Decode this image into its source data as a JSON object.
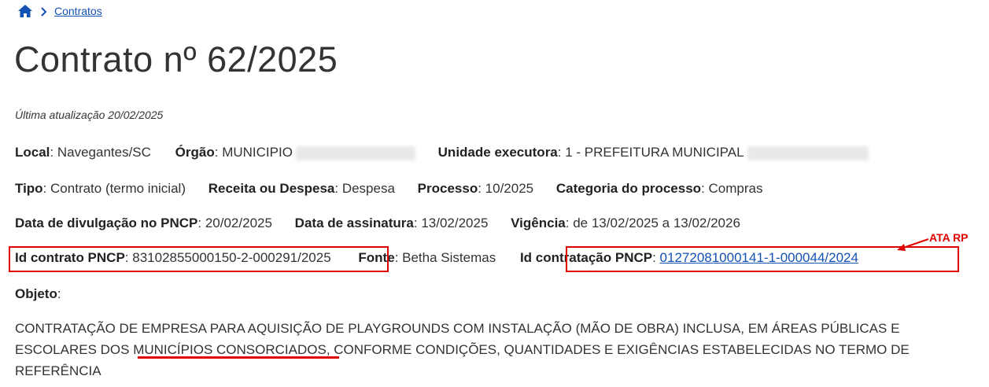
{
  "breadcrumb": {
    "home_icon": "home-icon",
    "separator_icon": "chevron-right-icon",
    "link": "Contratos"
  },
  "title": "Contrato nº 62/2025",
  "last_update": "Última atualização 20/02/2025",
  "fields": {
    "local_label": "Local",
    "local_value": "Navegantes/SC",
    "orgao_label": "Órgão",
    "orgao_value": "MUNICIPIO",
    "unidade_label": "Unidade executora",
    "unidade_value": "1 - PREFEITURA MUNICIPAL",
    "tipo_label": "Tipo",
    "tipo_value": "Contrato (termo inicial)",
    "receita_label": "Receita ou Despesa",
    "receita_value": "Despesa",
    "processo_label": "Processo",
    "processo_value": "10/2025",
    "categoria_label": "Categoria do processo",
    "categoria_value": "Compras",
    "divulgacao_label": "Data de divulgação no PNCP",
    "divulgacao_value": "20/02/2025",
    "assinatura_label": "Data de assinatura",
    "assinatura_value": "13/02/2025",
    "vigencia_label": "Vigência",
    "vigencia_value": "de 13/02/2025 a 13/02/2026",
    "id_contrato_label": "Id contrato PNCP",
    "id_contrato_value": "83102855000150-2-000291/2025",
    "fonte_label": "Fonte",
    "fonte_value": "Betha Sistemas",
    "id_contratacao_label": "Id contratação PNCP",
    "id_contratacao_value": "01272081000141-1-000044/2024",
    "objeto_label": "Objeto"
  },
  "objeto": {
    "part1": "CONTRATAÇÃO DE EMPRESA PARA AQUISIÇÃO DE PLAYGROUNDS COM INSTALAÇÃO (MÃO DE OBRA) INCLUSA, EM ÁREAS PÚBLICAS E ESCOLARES DOS ",
    "highlight": "MUNICÍPIOS CONSORCIADOS",
    "part2": ", CONFORME CONDIÇÕES, QUANTIDADES E EXIGÊNCIAS ESTABELECIDAS NO TERMO DE REFERÊNCIA"
  },
  "annotation": {
    "label": "ATA RP",
    "color": "#e00000"
  },
  "colors": {
    "link": "#1351b4",
    "text": "#333333",
    "annotation": "#e00000"
  }
}
